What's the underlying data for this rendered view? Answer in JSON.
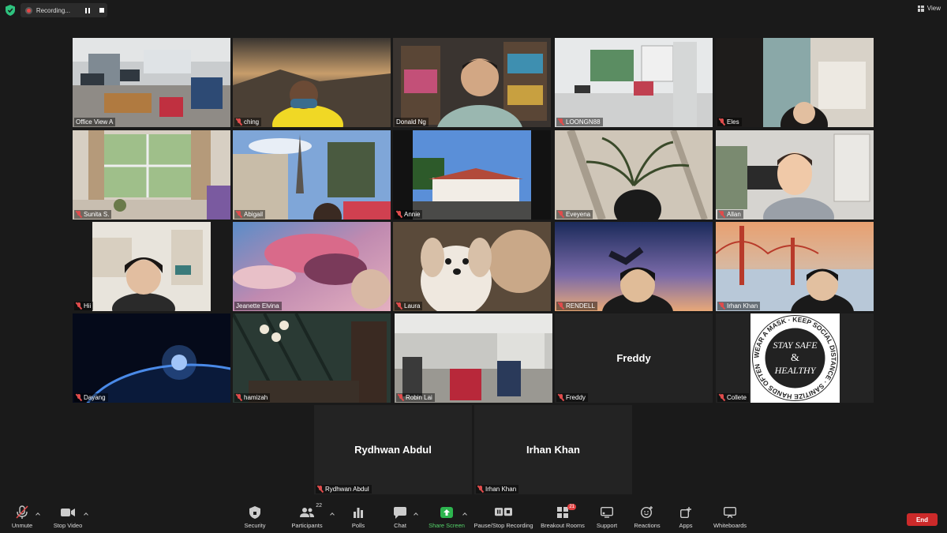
{
  "topbar": {
    "recording_label": "Recording...",
    "view_label": "View",
    "shield_color": "#2ec27e",
    "record_dot_color": "#e64545"
  },
  "participants": [
    {
      "name": "Office View A",
      "muted": false,
      "camera": true,
      "scene": "office"
    },
    {
      "name": "ching",
      "muted": true,
      "camera": true,
      "scene": "sunset-mountain"
    },
    {
      "name": "Donald Ng",
      "muted": false,
      "camera": true,
      "scene": "bookshelf",
      "active_speaker": true
    },
    {
      "name": "LOONGN88",
      "muted": true,
      "camera": true,
      "scene": "classroom"
    },
    {
      "name": "Eles",
      "muted": true,
      "camera": true,
      "scene": "curtain-room"
    },
    {
      "name": "Sunita S.",
      "muted": true,
      "camera": true,
      "scene": "window"
    },
    {
      "name": "Abigail",
      "muted": true,
      "camera": true,
      "scene": "paris"
    },
    {
      "name": "Annie",
      "muted": true,
      "camera": true,
      "scene": "villa"
    },
    {
      "name": "Eveyena",
      "muted": true,
      "camera": true,
      "scene": "plant-shadow"
    },
    {
      "name": "Allan",
      "muted": true,
      "camera": true,
      "scene": "avatar-room"
    },
    {
      "name": "Hii",
      "muted": true,
      "camera": true,
      "scene": "home-shelf"
    },
    {
      "name": "Jeanette Elvina",
      "muted": false,
      "camera": true,
      "scene": "pink-clouds"
    },
    {
      "name": "Laura",
      "muted": true,
      "camera": true,
      "scene": "dog"
    },
    {
      "name": "RENDELL",
      "muted": true,
      "camera": true,
      "scene": "night-sky"
    },
    {
      "name": "Irhan Khan",
      "muted": true,
      "camera": true,
      "scene": "golden-gate"
    },
    {
      "name": "Dayang",
      "muted": true,
      "camera": true,
      "scene": "earth"
    },
    {
      "name": "hamizah",
      "muted": true,
      "camera": true,
      "scene": "dark-room"
    },
    {
      "name": "Robin Lai",
      "muted": true,
      "camera": true,
      "scene": "office2"
    },
    {
      "name": "Freddy",
      "muted": true,
      "camera": false,
      "scene": "none"
    },
    {
      "name": "Collete",
      "muted": true,
      "camera": true,
      "scene": "stay-safe"
    },
    {
      "name": "Rydhwan Abdul",
      "muted": true,
      "camera": false,
      "scene": "none"
    },
    {
      "name": "Irhan Khan",
      "muted": true,
      "camera": false,
      "scene": "none"
    }
  ],
  "stay_safe_logo": {
    "ring_text": "WEAR A MASK · KEEP SOCIAL DISTANCE · SANITIZE HANDS OFTEN",
    "center_lines": [
      "STAY SAFE",
      "&",
      "HEALTHY"
    ]
  },
  "toolbar": {
    "unmute": "Unmute",
    "stop_video": "Stop Video",
    "security": "Security",
    "participants": "Participants",
    "participants_count": "22",
    "polls": "Polls",
    "chat": "Chat",
    "share_screen": "Share Screen",
    "pause_stop_recording": "Pause/Stop Recording",
    "breakout_rooms": "Breakout Rooms",
    "breakout_badge": "21",
    "support": "Support",
    "reactions": "Reactions",
    "apps": "Apps",
    "whiteboards": "Whiteboards",
    "end": "End",
    "end_color": "#cc2a2a",
    "share_color": "#2db54f"
  }
}
